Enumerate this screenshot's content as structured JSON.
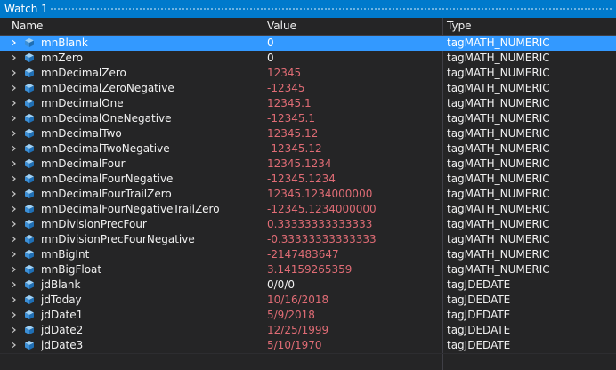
{
  "window": {
    "title": "Watch 1"
  },
  "columns": {
    "name": "Name",
    "value": "Value",
    "type": "Type"
  },
  "colors": {
    "accent": "#007acc",
    "selection": "#3399ff",
    "changed_value": "#e06c75"
  },
  "rows": [
    {
      "name": "mnBlank",
      "value": "0",
      "type": "tagMATH_NUMERIC",
      "selected": true,
      "changed": false
    },
    {
      "name": "mnZero",
      "value": "0",
      "type": "tagMATH_NUMERIC",
      "selected": false,
      "changed": false
    },
    {
      "name": "mnDecimalZero",
      "value": "12345",
      "type": "tagMATH_NUMERIC",
      "selected": false,
      "changed": true
    },
    {
      "name": "mnDecimalZeroNegative",
      "value": "-12345",
      "type": "tagMATH_NUMERIC",
      "selected": false,
      "changed": true
    },
    {
      "name": "mnDecimalOne",
      "value": "12345.1",
      "type": "tagMATH_NUMERIC",
      "selected": false,
      "changed": true
    },
    {
      "name": "mnDecimalOneNegative",
      "value": "-12345.1",
      "type": "tagMATH_NUMERIC",
      "selected": false,
      "changed": true
    },
    {
      "name": "mnDecimalTwo",
      "value": "12345.12",
      "type": "tagMATH_NUMERIC",
      "selected": false,
      "changed": true
    },
    {
      "name": "mnDecimalTwoNegative",
      "value": "-12345.12",
      "type": "tagMATH_NUMERIC",
      "selected": false,
      "changed": true
    },
    {
      "name": "mnDecimalFour",
      "value": "12345.1234",
      "type": "tagMATH_NUMERIC",
      "selected": false,
      "changed": true
    },
    {
      "name": "mnDecimalFourNegative",
      "value": "-12345.1234",
      "type": "tagMATH_NUMERIC",
      "selected": false,
      "changed": true
    },
    {
      "name": "mnDecimalFourTrailZero",
      "value": "12345.1234000000",
      "type": "tagMATH_NUMERIC",
      "selected": false,
      "changed": true
    },
    {
      "name": "mnDecimalFourNegativeTrailZero",
      "value": "-12345.1234000000",
      "type": "tagMATH_NUMERIC",
      "selected": false,
      "changed": true
    },
    {
      "name": "mnDivisionPrecFour",
      "value": "0.33333333333333",
      "type": "tagMATH_NUMERIC",
      "selected": false,
      "changed": true
    },
    {
      "name": "mnDivisionPrecFourNegative",
      "value": "-0.33333333333333",
      "type": "tagMATH_NUMERIC",
      "selected": false,
      "changed": true
    },
    {
      "name": "mnBigInt",
      "value": "-2147483647",
      "type": "tagMATH_NUMERIC",
      "selected": false,
      "changed": true
    },
    {
      "name": "mnBigFloat",
      "value": "3.14159265359",
      "type": "tagMATH_NUMERIC",
      "selected": false,
      "changed": true
    },
    {
      "name": "jdBlank",
      "value": "0/0/0",
      "type": "tagJDEDATE",
      "selected": false,
      "changed": false
    },
    {
      "name": "jdToday",
      "value": "10/16/2018",
      "type": "tagJDEDATE",
      "selected": false,
      "changed": true
    },
    {
      "name": "jdDate1",
      "value": "5/9/2018",
      "type": "tagJDEDATE",
      "selected": false,
      "changed": true
    },
    {
      "name": "jdDate2",
      "value": "12/25/1999",
      "type": "tagJDEDATE",
      "selected": false,
      "changed": true
    },
    {
      "name": "jdDate3",
      "value": "5/10/1970",
      "type": "tagJDEDATE",
      "selected": false,
      "changed": true
    }
  ]
}
